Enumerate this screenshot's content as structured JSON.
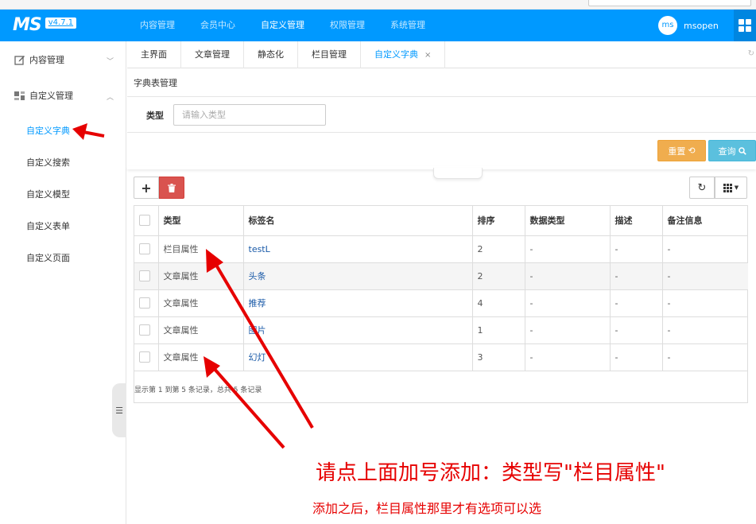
{
  "app": {
    "logo": "MS",
    "version": "v4.7.1"
  },
  "topnav": {
    "items": [
      "内容管理",
      "会员中心",
      "自定义管理",
      "权限管理",
      "系统管理"
    ],
    "active_index": 2
  },
  "user": {
    "avatar_text": "ms",
    "name": "msopen"
  },
  "sidebar": {
    "groups": [
      {
        "label": "内容管理",
        "icon": "edit-icon",
        "expanded": false
      },
      {
        "label": "自定义管理",
        "icon": "modules-icon",
        "expanded": true
      }
    ],
    "items": [
      "自定义字典",
      "自定义搜索",
      "自定义模型",
      "自定义表单",
      "自定义页面"
    ],
    "active_item": 0
  },
  "tabs": {
    "items": [
      "主界面",
      "文章管理",
      "静态化",
      "栏目管理",
      "自定义字典"
    ],
    "active_index": 4,
    "close_symbol": "×"
  },
  "breadcrumb": "字典表管理",
  "search": {
    "label": "类型",
    "placeholder": "请输入类型",
    "reset_label": "重置",
    "query_label": "查询"
  },
  "table": {
    "columns": [
      "类型",
      "标签名",
      "排序",
      "数据类型",
      "描述",
      "备注信息"
    ],
    "rows": [
      [
        "栏目属性",
        "testL",
        "2",
        "-",
        "-",
        "-"
      ],
      [
        "文章属性",
        "头条",
        "2",
        "-",
        "-",
        "-"
      ],
      [
        "文章属性",
        "推荐",
        "4",
        "-",
        "-",
        "-"
      ],
      [
        "文章属性",
        "图片",
        "1",
        "-",
        "-",
        "-"
      ],
      [
        "文章属性",
        "幻灯",
        "3",
        "-",
        "-",
        "-"
      ]
    ],
    "pagination_text": "显示第 1 到第 5 条记录，总共 5 条记录"
  },
  "annotations": {
    "line1": "请点上面加号添加：类型写\"栏目属性\"",
    "line2": "添加之后，栏目属性那里才有选项可以选",
    "color": "#e60000"
  },
  "colors": {
    "brand": "#0099ff",
    "warning": "#f0ad4e",
    "info": "#5bc0de",
    "danger": "#d9534f"
  }
}
